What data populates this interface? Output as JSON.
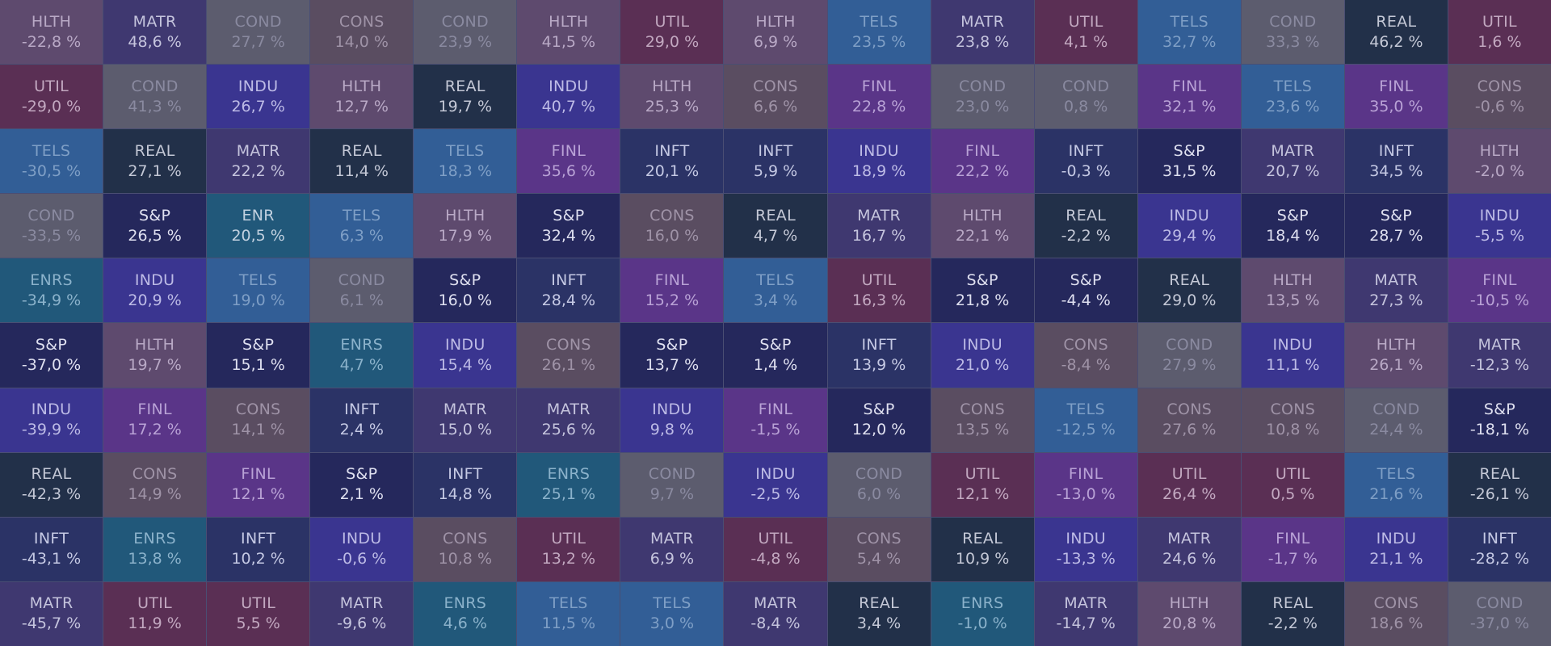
{
  "palette": {
    "HLTH": {
      "bg": "#5e4a6e",
      "fg": "#b9a9c6"
    },
    "MATR": {
      "bg": "#3f3870",
      "fg": "#c5c4dd"
    },
    "COND": {
      "bg": "#5c5c6e",
      "fg": "#8a8aa0"
    },
    "CONS": {
      "bg": "#5a4d61",
      "fg": "#9f93a7"
    },
    "UTIL": {
      "bg": "#5a2f54",
      "fg": "#c2a8c0"
    },
    "TELS": {
      "bg": "#325e96",
      "fg": "#7f9fc6"
    },
    "REAL": {
      "bg": "#223049",
      "fg": "#c4c8d6"
    },
    "INDU": {
      "bg": "#3a3590",
      "fg": "#bdbbe6"
    },
    "FINL": {
      "bg": "#5a3588",
      "fg": "#b9a2d6"
    },
    "INFT": {
      "bg": "#2b3366",
      "fg": "#c5c9e4"
    },
    "S&P": {
      "bg": "#25285c",
      "fg": "#dfe0f0"
    },
    "ENR": {
      "bg": "#21587a",
      "fg": "#c2d1e0"
    },
    "ENRS": {
      "bg": "#21587a",
      "fg": "#8bb2cb"
    }
  },
  "rows": [
    [
      [
        "HLTH",
        "-22,8 %"
      ],
      [
        "MATR",
        "48,6 %"
      ],
      [
        "COND",
        "27,7 %"
      ],
      [
        "CONS",
        "14,0 %"
      ],
      [
        "COND",
        "23,9 %"
      ],
      [
        "HLTH",
        "41,5 %"
      ],
      [
        "UTIL",
        "29,0 %"
      ],
      [
        "HLTH",
        "6,9 %"
      ],
      [
        "TELS",
        "23,5 %"
      ],
      [
        "MATR",
        "23,8 %"
      ],
      [
        "UTIL",
        "4,1 %"
      ],
      [
        "TELS",
        "32,7 %"
      ],
      [
        "COND",
        "33,3 %"
      ],
      [
        "REAL",
        "46,2 %"
      ],
      [
        "UTIL",
        "1,6 %"
      ]
    ],
    [
      [
        "UTIL",
        "-29,0 %"
      ],
      [
        "COND",
        "41,3 %"
      ],
      [
        "INDU",
        "26,7 %"
      ],
      [
        "HLTH",
        "12,7 %"
      ],
      [
        "REAL",
        "19,7 %"
      ],
      [
        "INDU",
        "40,7 %"
      ],
      [
        "HLTH",
        "25,3 %"
      ],
      [
        "CONS",
        "6,6 %"
      ],
      [
        "FINL",
        "22,8 %"
      ],
      [
        "COND",
        "23,0 %"
      ],
      [
        "COND",
        "0,8 %"
      ],
      [
        "FINL",
        "32,1 %"
      ],
      [
        "TELS",
        "23,6 %"
      ],
      [
        "FINL",
        "35,0 %"
      ],
      [
        "CONS",
        "-0,6 %"
      ]
    ],
    [
      [
        "TELS",
        "-30,5 %"
      ],
      [
        "REAL",
        "27,1 %"
      ],
      [
        "MATR",
        "22,2 %"
      ],
      [
        "REAL",
        "11,4 %"
      ],
      [
        "TELS",
        "18,3 %"
      ],
      [
        "FINL",
        "35,6 %"
      ],
      [
        "INFT",
        "20,1 %"
      ],
      [
        "INFT",
        "5,9 %"
      ],
      [
        "INDU",
        "18,9 %"
      ],
      [
        "FINL",
        "22,2 %"
      ],
      [
        "INFT",
        "-0,3 %"
      ],
      [
        "S&P",
        "31,5 %"
      ],
      [
        "MATR",
        "20,7 %"
      ],
      [
        "INFT",
        "34,5 %"
      ],
      [
        "HLTH",
        "-2,0 %"
      ]
    ],
    [
      [
        "COND",
        "-33,5 %"
      ],
      [
        "S&P",
        "26,5 %"
      ],
      [
        "ENR",
        "20,5 %"
      ],
      [
        "TELS",
        "6,3 %"
      ],
      [
        "HLTH",
        "17,9 %"
      ],
      [
        "S&P",
        "32,4 %"
      ],
      [
        "CONS",
        "16,0 %"
      ],
      [
        "REAL",
        "4,7 %"
      ],
      [
        "MATR",
        "16,7 %"
      ],
      [
        "HLTH",
        "22,1 %"
      ],
      [
        "REAL",
        "-2,2 %"
      ],
      [
        "INDU",
        "29,4 %"
      ],
      [
        "S&P",
        "18,4 %"
      ],
      [
        "S&P",
        "28,7 %"
      ],
      [
        "INDU",
        "-5,5 %"
      ]
    ],
    [
      [
        "ENRS",
        "-34,9 %"
      ],
      [
        "INDU",
        "20,9 %"
      ],
      [
        "TELS",
        "19,0 %"
      ],
      [
        "COND",
        "6,1 %"
      ],
      [
        "S&P",
        "16,0 %"
      ],
      [
        "INFT",
        "28,4 %"
      ],
      [
        "FINL",
        "15,2 %"
      ],
      [
        "TELS",
        "3,4 %"
      ],
      [
        "UTIL",
        "16,3 %"
      ],
      [
        "S&P",
        "21,8 %"
      ],
      [
        "S&P",
        "-4,4 %"
      ],
      [
        "REAL",
        "29,0 %"
      ],
      [
        "HLTH",
        "13,5 %"
      ],
      [
        "MATR",
        "27,3 %"
      ],
      [
        "FINL",
        "-10,5 %"
      ]
    ],
    [
      [
        "S&P",
        "-37,0 %"
      ],
      [
        "HLTH",
        "19,7 %"
      ],
      [
        "S&P",
        "15,1 %"
      ],
      [
        "ENRS",
        "4,7 %"
      ],
      [
        "INDU",
        "15,4 %"
      ],
      [
        "CONS",
        "26,1 %"
      ],
      [
        "S&P",
        "13,7 %"
      ],
      [
        "S&P",
        "1,4 %"
      ],
      [
        "INFT",
        "13,9 %"
      ],
      [
        "INDU",
        "21,0 %"
      ],
      [
        "CONS",
        "-8,4 %"
      ],
      [
        "COND",
        "27,9 %"
      ],
      [
        "INDU",
        "11,1 %"
      ],
      [
        "HLTH",
        "26,1 %"
      ],
      [
        "MATR",
        "-12,3 %"
      ]
    ],
    [
      [
        "INDU",
        "-39,9 %"
      ],
      [
        "FINL",
        "17,2 %"
      ],
      [
        "CONS",
        "14,1 %"
      ],
      [
        "INFT",
        "2,4 %"
      ],
      [
        "MATR",
        "15,0 %"
      ],
      [
        "MATR",
        "25,6 %"
      ],
      [
        "INDU",
        "9,8 %"
      ],
      [
        "FINL",
        "-1,5 %"
      ],
      [
        "S&P",
        "12,0 %"
      ],
      [
        "CONS",
        "13,5 %"
      ],
      [
        "TELS",
        "-12,5 %"
      ],
      [
        "CONS",
        "27,6 %"
      ],
      [
        "CONS",
        "10,8 %"
      ],
      [
        "COND",
        "24,4 %"
      ],
      [
        "S&P",
        "-18,1 %"
      ]
    ],
    [
      [
        "REAL",
        "-42,3 %"
      ],
      [
        "CONS",
        "14,9 %"
      ],
      [
        "FINL",
        "12,1 %"
      ],
      [
        "S&P",
        "2,1 %"
      ],
      [
        "INFT",
        "14,8 %"
      ],
      [
        "ENRS",
        "25,1 %"
      ],
      [
        "COND",
        "9,7 %"
      ],
      [
        "INDU",
        "-2,5 %"
      ],
      [
        "COND",
        "6,0 %"
      ],
      [
        "UTIL",
        "12,1 %"
      ],
      [
        "FINL",
        "-13,0 %"
      ],
      [
        "UTIL",
        "26,4 %"
      ],
      [
        "UTIL",
        "0,5 %"
      ],
      [
        "TELS",
        "21,6 %"
      ],
      [
        "REAL",
        "-26,1 %"
      ]
    ],
    [
      [
        "INFT",
        "-43,1 %"
      ],
      [
        "ENRS",
        "13,8 %"
      ],
      [
        "INFT",
        "10,2 %"
      ],
      [
        "INDU",
        "-0,6 %"
      ],
      [
        "CONS",
        "10,8 %"
      ],
      [
        "UTIL",
        "13,2 %"
      ],
      [
        "MATR",
        "6,9 %"
      ],
      [
        "UTIL",
        "-4,8 %"
      ],
      [
        "CONS",
        "5,4 %"
      ],
      [
        "REAL",
        "10,9 %"
      ],
      [
        "INDU",
        "-13,3 %"
      ],
      [
        "MATR",
        "24,6 %"
      ],
      [
        "FINL",
        "-1,7 %"
      ],
      [
        "INDU",
        "21,1 %"
      ],
      [
        "INFT",
        "-28,2 %"
      ]
    ],
    [
      [
        "MATR",
        "-45,7 %"
      ],
      [
        "UTIL",
        "11,9 %"
      ],
      [
        "UTIL",
        "5,5 %"
      ],
      [
        "MATR",
        "-9,6 %"
      ],
      [
        "ENRS",
        "4,6 %"
      ],
      [
        "TELS",
        "11,5 %"
      ],
      [
        "TELS",
        "3,0 %"
      ],
      [
        "MATR",
        "-8,4 %"
      ],
      [
        "REAL",
        "3,4 %"
      ],
      [
        "ENRS",
        "-1,0 %"
      ],
      [
        "MATR",
        "-14,7 %"
      ],
      [
        "HLTH",
        "20,8 %"
      ],
      [
        "REAL",
        "-2,2 %"
      ],
      [
        "CONS",
        "18,6 %"
      ],
      [
        "COND",
        "-37,0 %"
      ]
    ]
  ]
}
